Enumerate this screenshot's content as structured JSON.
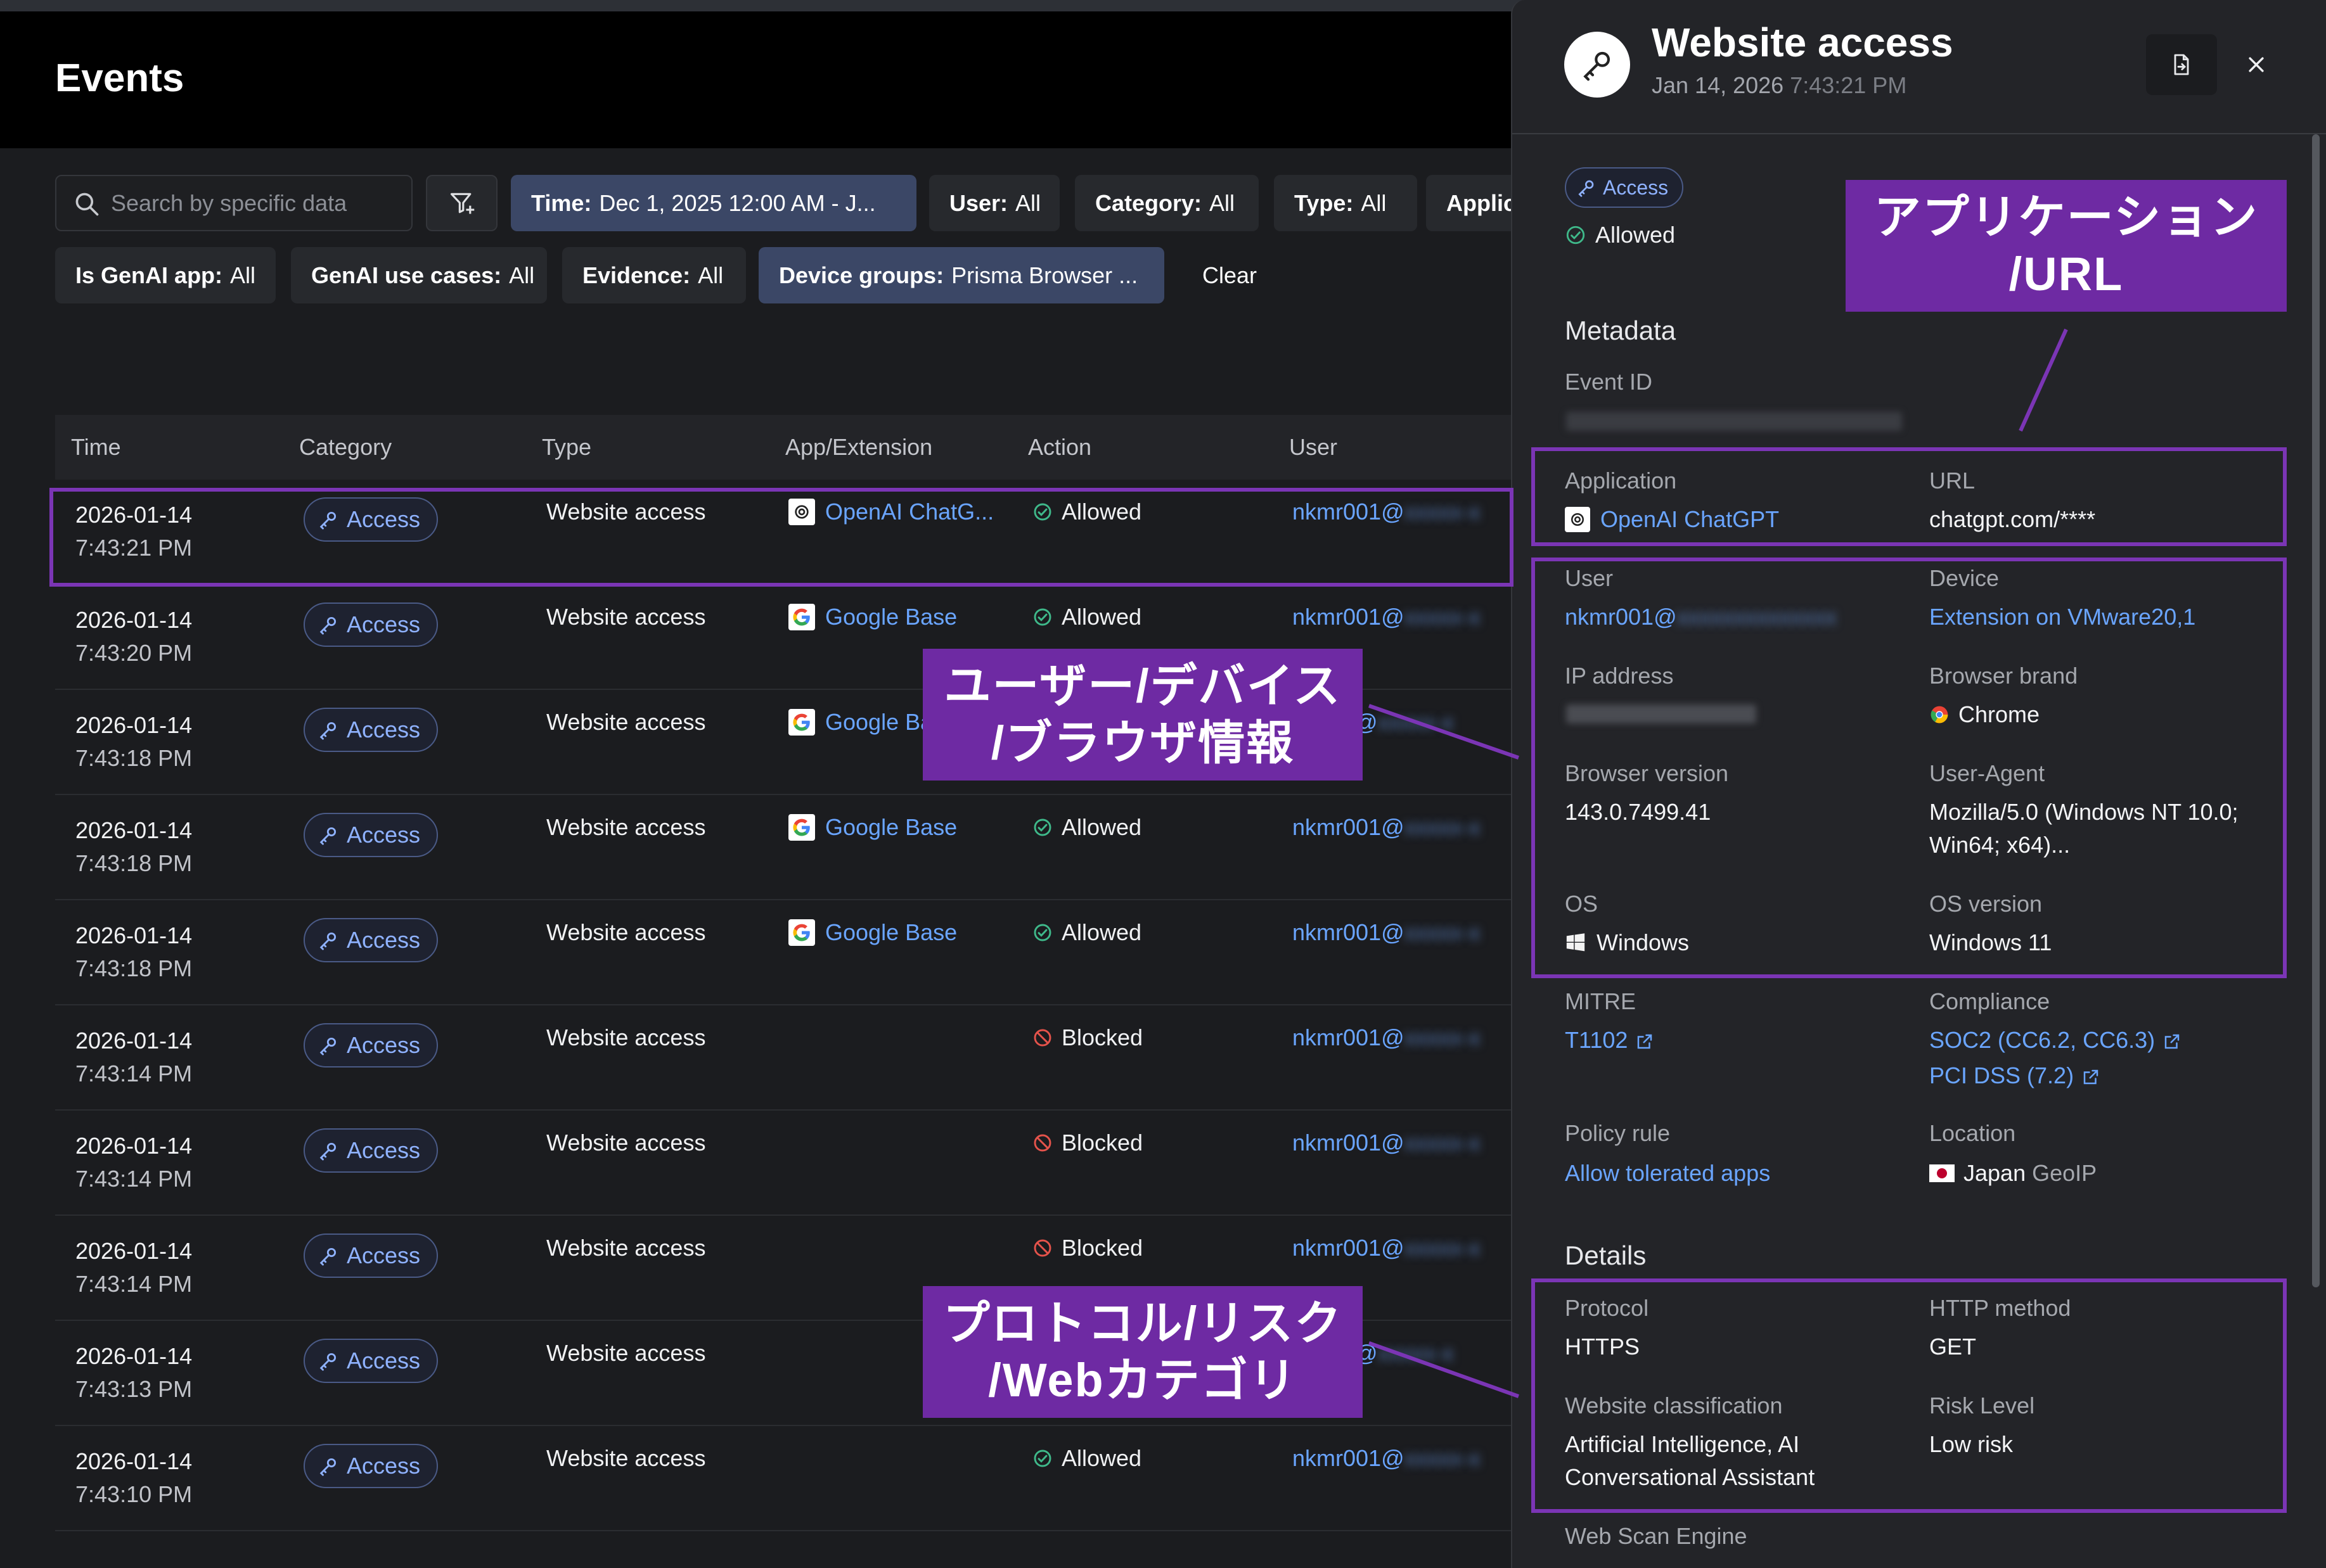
{
  "page": {
    "title": "Events"
  },
  "search": {
    "placeholder": "Search by specific data"
  },
  "filters": [
    {
      "key": "Time:",
      "value": "Dec 1, 2025 12:00 AM - J...",
      "active": true
    },
    {
      "key": "User:",
      "value": "All",
      "active": false
    },
    {
      "key": "Category:",
      "value": "All",
      "active": false
    },
    {
      "key": "Type:",
      "value": "All",
      "active": false
    },
    {
      "key": "Applic",
      "value": "",
      "active": false
    },
    {
      "key": "Is GenAI app:",
      "value": "All",
      "active": false
    },
    {
      "key": "GenAI use cases:",
      "value": "All",
      "active": false
    },
    {
      "key": "Evidence:",
      "value": "All",
      "active": false
    },
    {
      "key": "Device groups:",
      "value": "Prisma Browser ...",
      "active": true
    }
  ],
  "clear_label": "Clear",
  "table": {
    "columns": [
      "Time",
      "Category",
      "Type",
      "App/Extension",
      "Action",
      "User"
    ],
    "rows": [
      {
        "date": "2026-01-14",
        "time": "7:43:21 PM",
        "category": "Access",
        "type": "Website access",
        "app": "OpenAI ChatG...",
        "app_icon": "openai-icon",
        "action": "Allowed",
        "user": "nkmr001@"
      },
      {
        "date": "2026-01-14",
        "time": "7:43:20 PM",
        "category": "Access",
        "type": "Website access",
        "app": "Google Base",
        "app_icon": "google-icon",
        "action": "Allowed",
        "user": "nkmr001@"
      },
      {
        "date": "2026-01-14",
        "time": "7:43:18 PM",
        "category": "Access",
        "type": "Website access",
        "app": "Google Ba",
        "app_icon": "google-icon",
        "action": "",
        "user": "01@"
      },
      {
        "date": "2026-01-14",
        "time": "7:43:18 PM",
        "category": "Access",
        "type": "Website access",
        "app": "Google Base",
        "app_icon": "google-icon",
        "action": "Allowed",
        "user": "nkmr001@"
      },
      {
        "date": "2026-01-14",
        "time": "7:43:18 PM",
        "category": "Access",
        "type": "Website access",
        "app": "Google Base",
        "app_icon": "google-icon",
        "action": "Allowed",
        "user": "nkmr001@"
      },
      {
        "date": "2026-01-14",
        "time": "7:43:14 PM",
        "category": "Access",
        "type": "Website access",
        "app": "",
        "app_icon": "",
        "action": "Blocked",
        "user": "nkmr001@"
      },
      {
        "date": "2026-01-14",
        "time": "7:43:14 PM",
        "category": "Access",
        "type": "Website access",
        "app": "",
        "app_icon": "",
        "action": "Blocked",
        "user": "nkmr001@"
      },
      {
        "date": "2026-01-14",
        "time": "7:43:14 PM",
        "category": "Access",
        "type": "Website access",
        "app": "",
        "app_icon": "",
        "action": "Blocked",
        "user": "nkmr001@"
      },
      {
        "date": "2026-01-14",
        "time": "7:43:13 PM",
        "category": "Access",
        "type": "Website access",
        "app": "",
        "app_icon": "",
        "action": "",
        "user": "01@"
      },
      {
        "date": "2026-01-14",
        "time": "7:43:10 PM",
        "category": "Access",
        "type": "Website access",
        "app": "",
        "app_icon": "",
        "action": "Allowed",
        "user": "nkmr001@"
      }
    ]
  },
  "drawer": {
    "title": "Website access",
    "date": "Jan 14, 2026",
    "time": "7:43:21 PM",
    "category": "Access",
    "status": "Allowed",
    "metadata_heading": "Metadata",
    "event_id_label": "Event ID",
    "application_label": "Application",
    "application_value": "OpenAI ChatGPT",
    "url_label": "URL",
    "url_value": "chatgpt.com/****",
    "user_label": "User",
    "user_value": "nkmr001@",
    "device_label": "Device",
    "device_value": "Extension on VMware20,1",
    "ip_label": "IP address",
    "browser_brand_label": "Browser brand",
    "browser_brand_value": "Chrome",
    "browser_version_label": "Browser version",
    "browser_version_value": "143.0.7499.41",
    "user_agent_label": "User-Agent",
    "user_agent_line1": "Mozilla/5.0 (Windows NT 10.0;",
    "user_agent_line2": "Win64; x64)...",
    "os_label": "OS",
    "os_value": "Windows",
    "os_version_label": "OS version",
    "os_version_value": "Windows 11",
    "mitre_label": "MITRE",
    "mitre_value": "T1102",
    "compliance_label": "Compliance",
    "compliance_1": "SOC2 (CC6.2, CC6.3)",
    "compliance_2": "PCI DSS (7.2)",
    "policy_label": "Policy rule",
    "policy_value": "Allow tolerated apps",
    "location_label": "Location",
    "location_value": "Japan",
    "location_suffix": "GeoIP",
    "details_heading": "Details",
    "protocol_label": "Protocol",
    "protocol_value": "HTTPS",
    "http_method_label": "HTTP method",
    "http_method_value": "GET",
    "web_class_label": "Website classification",
    "web_class_line1": "Artificial Intelligence, AI",
    "web_class_line2": "Conversational Assistant",
    "risk_label": "Risk Level",
    "risk_value": "Low risk",
    "web_scan_label": "Web Scan Engine"
  },
  "annotations": {
    "app_url_line1": "アプリケーション",
    "app_url_line2": "/URL",
    "user_device_line1": "ユーザー/デバイス",
    "user_device_line2": "/ブラウザ情報",
    "protocol_line1": "プロトコル/リスク",
    "protocol_line2": "/Webカテゴリ"
  },
  "colors": {
    "accent_link": "#6aa5ff",
    "annotation_purple": "#6e2aa3",
    "allowed_green": "#3fb98a",
    "blocked_red": "#e5534b"
  }
}
